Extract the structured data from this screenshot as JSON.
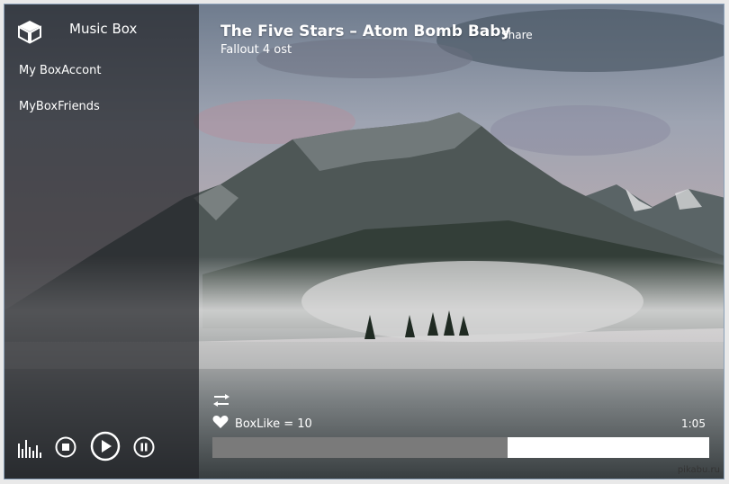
{
  "app": {
    "title": "Music Box"
  },
  "sidebar": {
    "items": [
      {
        "label": "My BoxAccont"
      },
      {
        "label": "MyBoxFriends"
      }
    ]
  },
  "track": {
    "title": "The Five Stars – Atom Bomb Baby",
    "album": "Fallout 4 ost",
    "share_label": "Share",
    "likes_label": "BoxLike = 10",
    "time": "1:05",
    "progress_fraction": 0.595
  },
  "controls": {
    "icons": [
      "equalizer-icon",
      "stop-icon",
      "play-icon",
      "pause-icon",
      "shuffle-icon",
      "heart-icon"
    ]
  },
  "watermark": "pikabu.ru",
  "colors": {
    "sidebar_overlay": "#22242899",
    "progress_fill": "#7a7a7a",
    "progress_track": "#ffffff",
    "text": "#ffffff"
  }
}
